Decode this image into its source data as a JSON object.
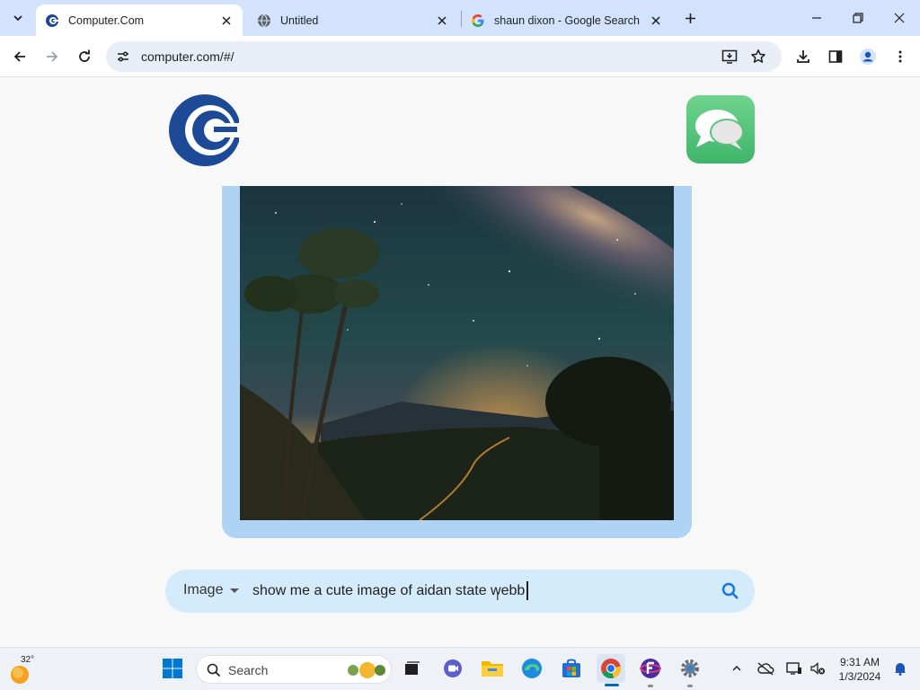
{
  "browser": {
    "tabs": [
      {
        "title": "Computer.Com",
        "favicon": "computer-com-favicon",
        "active": true
      },
      {
        "title": "Untitled",
        "favicon": "globe-icon",
        "active": false
      },
      {
        "title": "shaun dixon - Google Search",
        "favicon": "google-icon",
        "active": false
      }
    ],
    "url": "computer.com/#/",
    "accent": "#d3e3fd"
  },
  "page": {
    "logo": "computer-com-logo",
    "messages_icon": "messages-icon",
    "image_alt": "Milky way over a mountain forest at night",
    "query_type": "Image",
    "query_text": "show me a cute image of aidan state webb",
    "card_color": "#aed3f5",
    "query_bar_color": "#d4ebfb"
  },
  "taskbar": {
    "weather_temp": "32°",
    "search_label": "Search",
    "time": "9:31 AM",
    "date": "1/3/2024"
  }
}
